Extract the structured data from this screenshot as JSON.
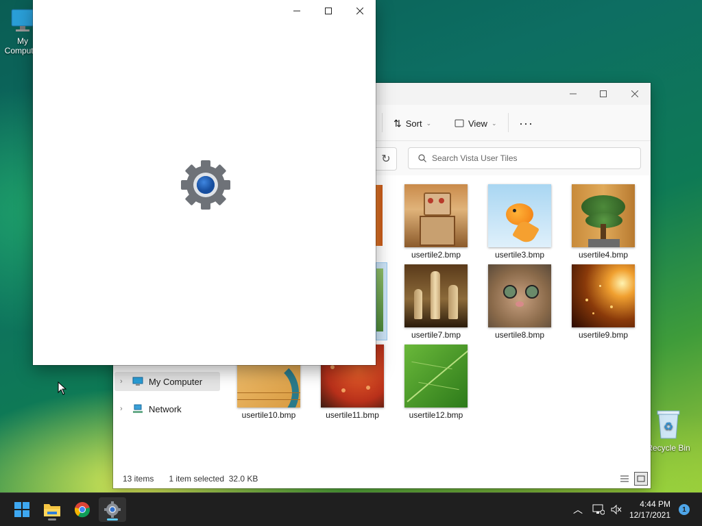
{
  "desktop": {
    "icons": [
      {
        "label": "My Computer"
      },
      {
        "label": "Recycle Bin"
      }
    ]
  },
  "settings_window": {
    "controls": {
      "minimize": "—",
      "maximize": "☐",
      "close": "✕"
    }
  },
  "explorer": {
    "toolbar": {
      "sort_label": "Sort",
      "view_label": "View",
      "more_label": "···"
    },
    "search": {
      "placeholder": "Search Vista User Tiles"
    },
    "nav": [
      {
        "label": "My Computer"
      },
      {
        "label": "Network"
      }
    ],
    "files": [
      {
        "name": "usertile2.bmp",
        "thumb": "robot"
      },
      {
        "name": "usertile3.bmp",
        "thumb": "goldfish"
      },
      {
        "name": "usertile4.bmp",
        "thumb": "bonsai"
      },
      {
        "name": "usertile7.bmp",
        "thumb": "chess"
      },
      {
        "name": "usertile8.bmp",
        "thumb": "kitten"
      },
      {
        "name": "usertile9.bmp",
        "thumb": "sparkles"
      },
      {
        "name": "usertile10.bmp",
        "thumb": "bass-clef"
      },
      {
        "name": "usertile11.bmp",
        "thumb": "starfish"
      },
      {
        "name": "usertile12.bmp",
        "thumb": "leaf"
      }
    ],
    "status": {
      "count": "13 items",
      "selection": "1 item selected  32.0 KB"
    }
  },
  "taskbar": {
    "clock_time": "4:44 PM",
    "clock_date": "12/17/2021",
    "notification_count": "1",
    "apps": [
      "start-icon",
      "file-explorer-icon",
      "chrome-icon",
      "settings-icon"
    ]
  }
}
